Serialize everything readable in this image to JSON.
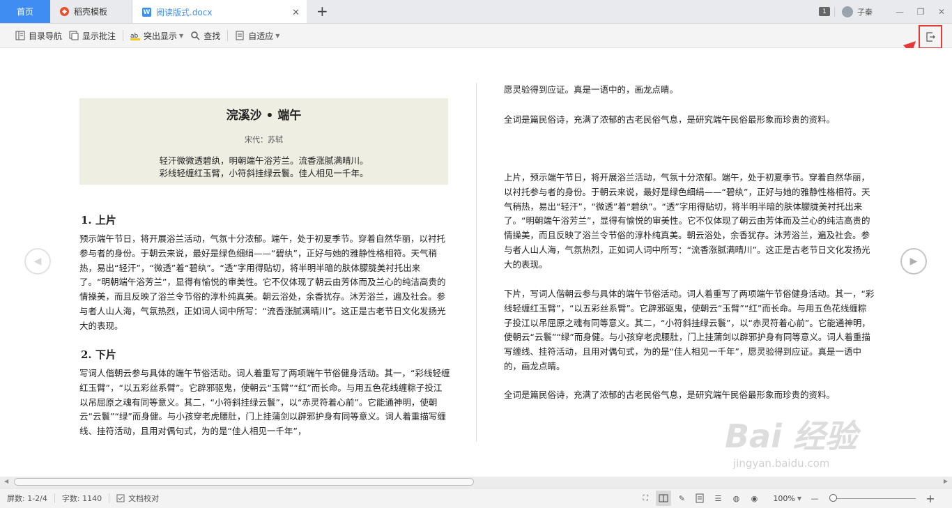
{
  "tabs": {
    "home": "首页",
    "template": "稻壳模板",
    "document": "阅读版式.docx",
    "page_badge": "1",
    "user": "子秦"
  },
  "toolbar": {
    "nav": "目录导航",
    "comments": "显示批注",
    "highlight": "突出显示",
    "find": "查找",
    "fit": "自适应"
  },
  "poem": {
    "title": "浣溪沙 • 端午",
    "author": "宋代：苏轼",
    "line1": "轻汗微微透碧纨，明朝端午浴芳兰。流香涨腻满晴川。",
    "line2": "彩线轻缠红玉臂，小符斜挂绿云鬟。佳人相见一千年。"
  },
  "left": {
    "h1": "1.  上片",
    "p1": "预示端午节日，将开展浴兰活动，气氛十分浓郁。端午，处于初夏季节。穿着自然华丽，以衬托参与者的身份。于朝云来说，最好是绿色细绢——“碧纨”，正好与她的雅静性格相符。天气稍热，易出“轻汗”，“微透”着“碧纨”。“透”字用得贴切，将半明半暗的肤体朦胧美衬托出来了。“明朝端午浴芳兰”，显得有愉悦的审美性。它不仅体现了朝云由芳体而及兰心的纯洁高贵的情操美，而且反映了浴兰令节俗的淳朴纯真美。朝云浴处，余香犹存。沐芳浴兰，遍及社会。参与者人山人海，气氛热烈，正如词人词中所写：“流香涨腻满晴川”。这正是古老节日文化发扬光大的表现。",
    "h2": "2.  下片",
    "p2": "写词人偕朝云参与具体的端午节俗活动。词人着重写了两项端午节俗健身活动。其一，“彩线轻缠红玉臂”，“以五彩丝系臂”。它辟邪驱鬼，使朝云“玉臂”“红”而长命。与用五色花线缠粽子投江以吊屈原之魂有同等意义。其二，“小符斜挂绿云鬟”，以“赤灵符着心前”。它能通神明，使朝云“云鬟”“绿”而身健。与小孩穿老虎腰肚，门上挂蒲剑以辟邪护身有同等意义。词人着重描写缠线、挂符活动，且用对偶句式，为的是“佳人相见一千年”，"
  },
  "right": {
    "p1": "愿灵验得到应证。真是一语中的，画龙点睛。",
    "p2": "全词是篇民俗诗，充满了浓郁的古老民俗气息，是研究端午民俗最形象而珍贵的资料。",
    "p3": "上片，预示端午节日，将开展浴兰活动，气氛十分浓郁。端午，处于初夏季节。穿着自然华丽，以衬托参与者的身份。于朝云来说，最好是绿色细绢——“碧纨”，正好与她的雅静性格相符。天气稍热，易出“轻汗”，“微透”着“碧纨”。“透”字用得贴切，将半明半暗的肤体朦胧美衬托出来了。“明朝端午浴芳兰”，显得有愉悦的审美性。它不仅体现了朝云由芳体而及兰心的纯洁高贵的情操美，而且反映了浴兰令节俗的淳朴纯真美。朝云浴处，余香犹存。沐芳浴兰，遍及社会。参与者人山人海，气氛热烈，正如词人词中所写：“流香涨腻满晴川”。这正是古老节日文化发扬光大的表现。",
    "p4": "下片，写词人偕朝云参与具体的端午节俗活动。词人着重写了两项端午节俗健身活动。其一，“彩线轻缠红玉臂”，“以五彩丝系臂”。它辟邪驱鬼，使朝云“玉臂”“红”而长命。与用五色花线缠粽子投江以吊屈原之魂有同等意义。其二，“小符斜挂绿云鬟”，以“赤灵符着心前”。它能通神明，使朝云“云鬟”“绿”而身健。与小孩穿老虎腰肚，门上挂蒲剑以辟邪护身有同等意义。词人着重描写缠线、挂符活动，且用对偶句式，为的是“佳人相见一千年”，愿灵验得到应证。真是一语中的，画龙点睛。",
    "p5": "全词是篇民俗诗，充满了浓郁的古老民俗气息，是研究端午民俗最形象而珍贵的资料。"
  },
  "status": {
    "screens": "屏数: 1-2/4",
    "words": "字数: 1140",
    "proofread": "文档校对",
    "zoom": "100%",
    "zoom_fraction": 0.0
  },
  "watermark": {
    "logo": "Bai 经验",
    "url": "jingyan.baidu.com"
  },
  "colors": {
    "accent": "#3f8df2",
    "highlight_box": "#e53935",
    "poem_bg": "#efeee3"
  }
}
